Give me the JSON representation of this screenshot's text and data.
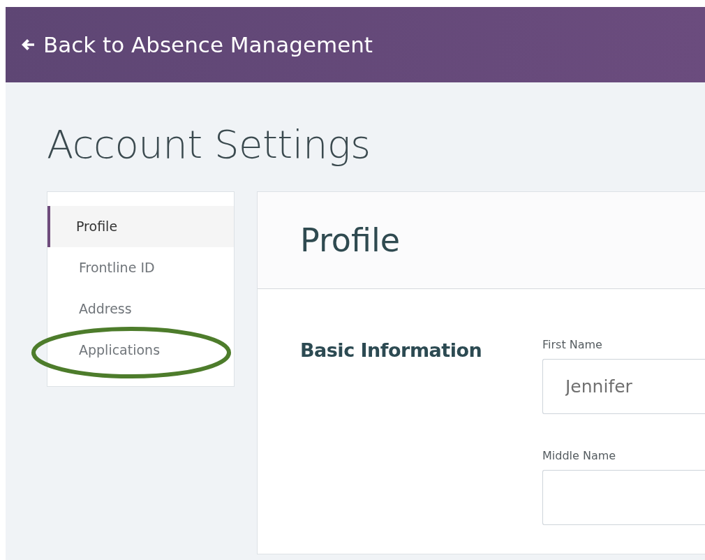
{
  "header": {
    "back_link": "Back to Absence Management"
  },
  "page_title": "Account Settings",
  "sidebar": {
    "items": [
      {
        "label": "Profile",
        "selected": true,
        "circled": false
      },
      {
        "label": "Frontline ID",
        "selected": false,
        "circled": false
      },
      {
        "label": "Address",
        "selected": false,
        "circled": false
      },
      {
        "label": "Applications",
        "selected": false,
        "circled": true
      }
    ]
  },
  "panel": {
    "title": "Profile",
    "section": "Basic Information",
    "fields": [
      {
        "label": "First Name",
        "value": "Jennifer"
      },
      {
        "label": "Middle Name"
      }
    ]
  }
}
